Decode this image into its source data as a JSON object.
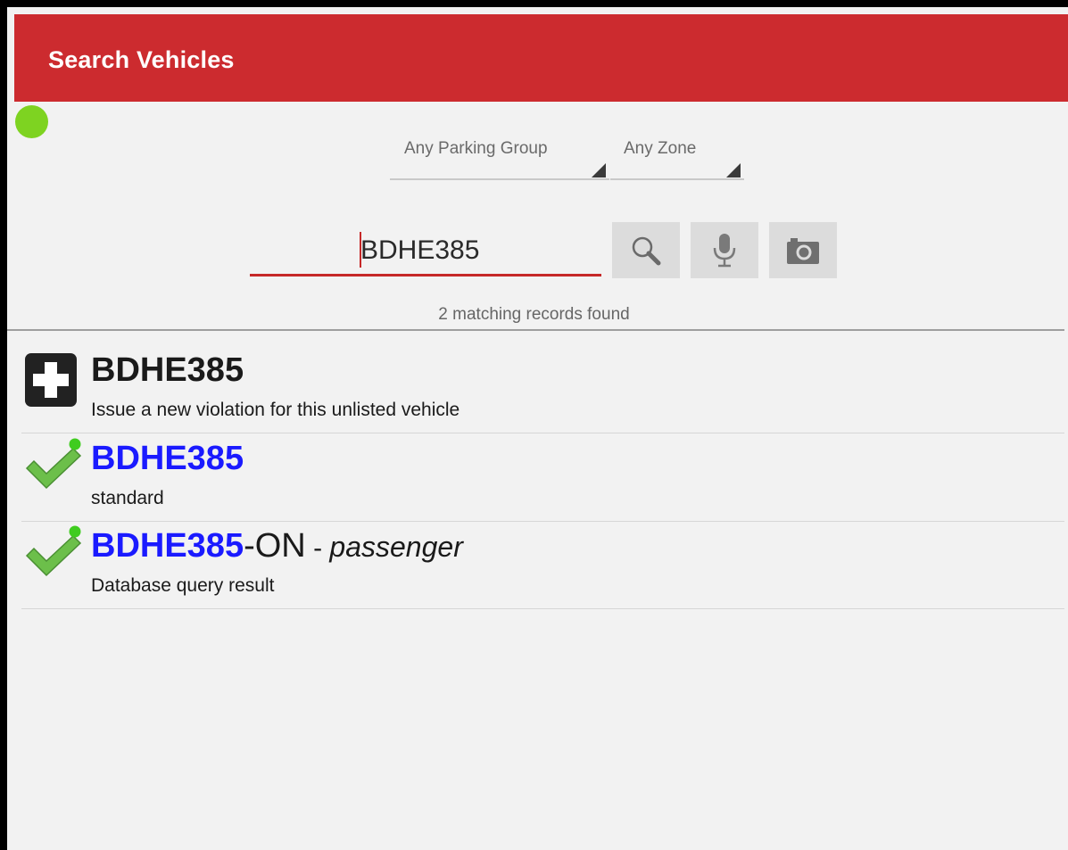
{
  "appbar": {
    "title": "Search Vehicles"
  },
  "status": {
    "color": "#7ed321",
    "icon": "status-dot-icon"
  },
  "filters": {
    "parking_group": "Any Parking Group",
    "zone": "Any Zone"
  },
  "search": {
    "value": "BDHE385",
    "buttons": [
      "search-icon",
      "microphone-icon",
      "camera-icon"
    ]
  },
  "results": {
    "count_text": "2 matching records found",
    "items": [
      {
        "icon": "add-icon",
        "title": "BDHE385",
        "subtitle": "Issue a new violation for this unlisted vehicle"
      },
      {
        "icon": "check-icon",
        "title": "BDHE385",
        "subtitle": "standard"
      },
      {
        "icon": "check-icon",
        "title": "BDHE385",
        "title_suffix": "-ON",
        "title_sep": " - ",
        "title_type": "passenger",
        "subtitle": "Database query result"
      }
    ]
  },
  "colors": {
    "accent": "#cc2b2f",
    "link": "#1a1aff",
    "ok_green": "#7ed321"
  }
}
